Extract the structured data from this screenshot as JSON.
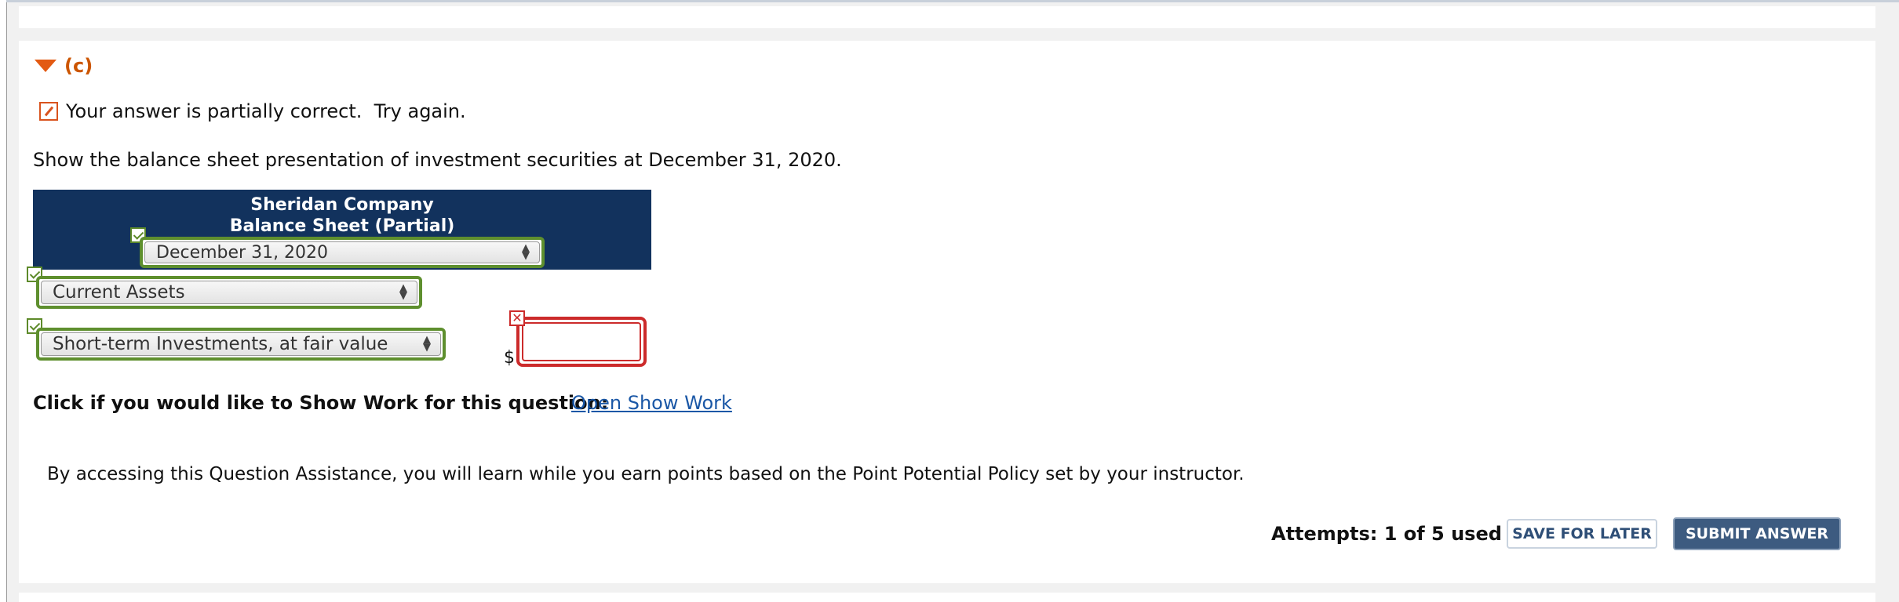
{
  "part": {
    "label": "(c)"
  },
  "feedback": {
    "text": "Your answer is partially correct.  Try again."
  },
  "question": {
    "text": "Show the balance sheet presentation of investment securities at December 31, 2020."
  },
  "statement": {
    "company": "Sheridan Company",
    "title": "Balance Sheet (Partial)",
    "date_select": {
      "value": "December 31, 2020",
      "status": "correct"
    }
  },
  "section_select": {
    "value": "Current Assets",
    "status": "correct"
  },
  "line_item": {
    "account_select": {
      "value": "Short-term Investments, at fair value",
      "status": "correct"
    },
    "currency": "$",
    "amount": {
      "value": "",
      "status": "incorrect"
    }
  },
  "show_work": {
    "label": "Click if you would like to Show Work for this question:",
    "link": "Open Show Work"
  },
  "assistance": {
    "text": "By accessing this Question Assistance, you will learn while you earn points based on the Point Potential Policy set by your instructor."
  },
  "footer": {
    "attempts": "Attempts: 1 of 5 used",
    "save_label": "SAVE FOR LATER",
    "submit_label": "SUBMIT ANSWER"
  },
  "colors": {
    "header_bg": "#12325d",
    "correct": "#5e8f2e",
    "incorrect": "#cc2b2b",
    "accent": "#e35a12",
    "link": "#1a57a6"
  }
}
